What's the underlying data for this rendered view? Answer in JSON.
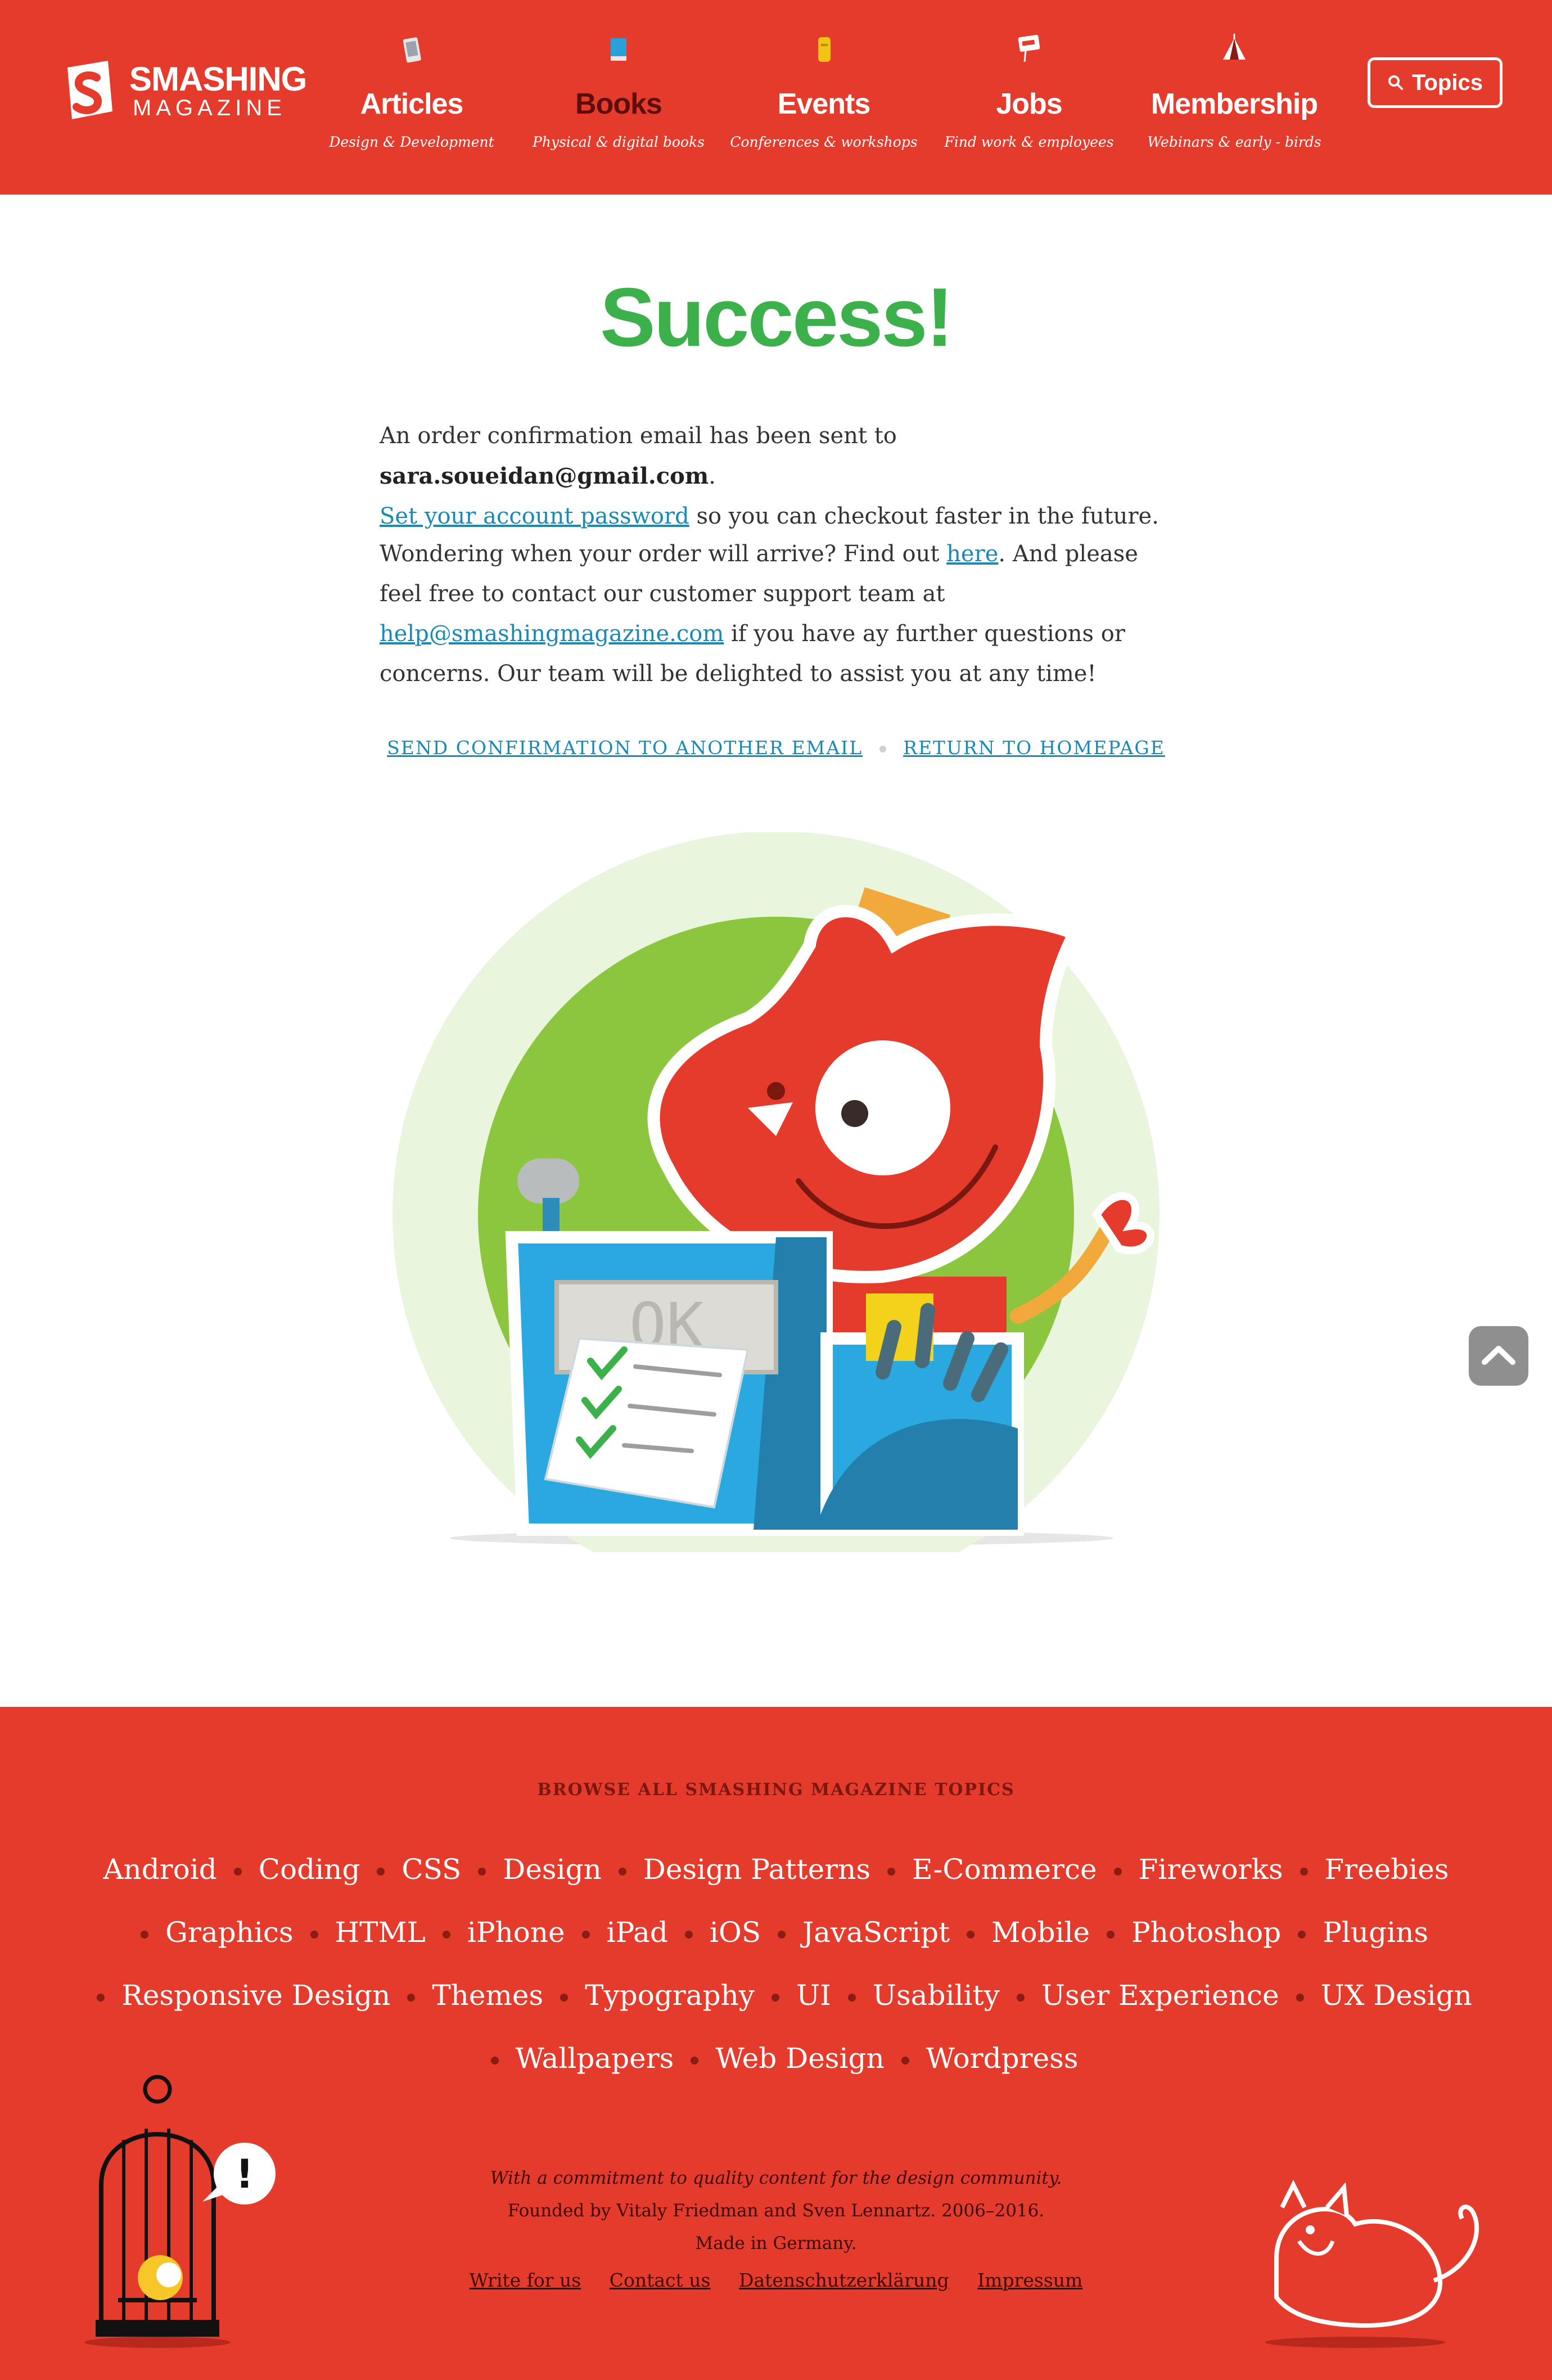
{
  "header": {
    "brand_line1": "SMASHING",
    "brand_line2": "MAGAZINE",
    "brand_color": "#e53b2c",
    "nav": [
      {
        "label": "Articles",
        "sub": "Design & Development",
        "icon": "phone-icon"
      },
      {
        "label": "Books",
        "sub": "Physical & digital books",
        "icon": "book-icon"
      },
      {
        "label": "Events",
        "sub": "Conferences & workshops",
        "icon": "ticket-icon"
      },
      {
        "label": "Jobs",
        "sub": "Find work & employees",
        "icon": "open-sign-icon"
      },
      {
        "label": "Membership",
        "sub": "Webinars & early - birds",
        "icon": "tent-icon"
      }
    ],
    "topics_label": "Topics"
  },
  "main": {
    "title": "Success!",
    "title_color": "#3cb04a",
    "p1_text1": "An order confirmation email has been sent to ",
    "p1_email": "sara.soueidan@gmail.com",
    "p1_text2": ".",
    "p1_link": "Set your account password",
    "p1_text3": " so you can checkout faster in the future.",
    "p2_text1": "Wondering when your order will arrive? Find out ",
    "p2_link1": "here",
    "p2_text2": ". And please feel free to contact our customer support team at ",
    "p2_link2": "help@smashingmagazine.com",
    "p2_text3": " if you have ay further questions or concerns. Our team will be delighted to assist you at any time!",
    "action1": "SEND CONFIRMATION TO ANOTHER EMAIL",
    "action2": "RETURN TO HOMEPAGE",
    "register_display": "OK",
    "link_color": "#1a8ab5"
  },
  "footer": {
    "heading": "BROWSE ALL SMASHING MAGAZINE TOPICS",
    "topics": [
      "Android",
      "Coding",
      "CSS",
      "Design",
      "Design Patterns",
      "E-Commerce",
      "Fireworks",
      "Freebies",
      "Graphics",
      "HTML",
      "iPhone",
      "iPad",
      "iOS",
      "JavaScript",
      "Mobile",
      "Photoshop",
      "Plugins",
      "Responsive Design",
      "Themes",
      "Typography",
      "UI",
      "Usability",
      "User Experience",
      "UX Design",
      "Wallpapers",
      "Web Design",
      "Wordpress"
    ],
    "tagline": "With a commitment to quality content for the design community.",
    "founded": "Founded by Vitaly Friedman and Sven Lennartz. 2006–2016.",
    "made_in": "Made in Germany.",
    "links": [
      "Write for us",
      "Contact us",
      "Datenschutzerklärung",
      "Impressum"
    ],
    "speech_mark": "!"
  }
}
